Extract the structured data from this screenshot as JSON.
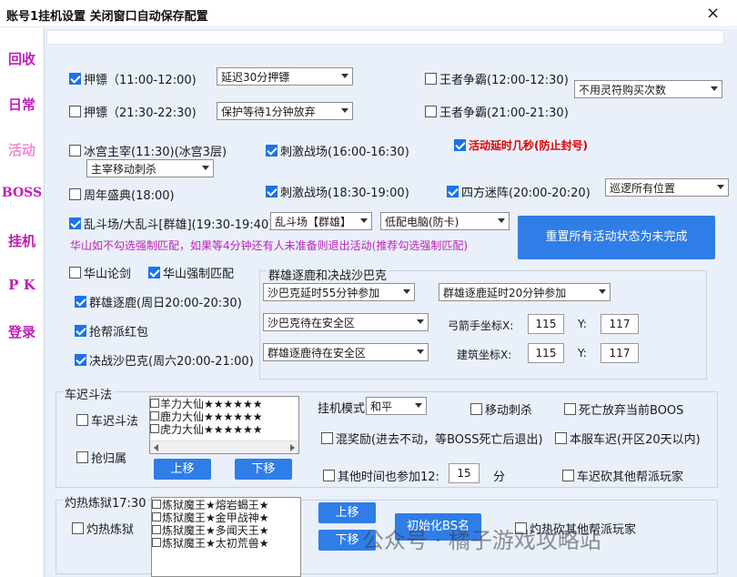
{
  "window": {
    "title": "账号1挂机设置   关闭窗口自动保存配置",
    "close_glyph": "×"
  },
  "sidebar": {
    "items": [
      "回收",
      "日常",
      "活动",
      "BOSS",
      "挂机",
      "P K",
      "登录"
    ],
    "active_color": "#f28ad6",
    "color": "#c01fb7"
  },
  "rows": {
    "yabiao1": {
      "label": "押镖（11:00-12:00)",
      "checked": true,
      "select": "延迟30分押镖"
    },
    "yabiao2": {
      "label": "押镖（21:30-22:30)",
      "checked": false,
      "select": "保护等待1分钟放弃"
    },
    "wangzhe1": {
      "label": "王者争霸(12:00-12:30)",
      "checked": false
    },
    "wangzhe2": {
      "label": "王者争霸(21:00-21:30)",
      "checked": false
    },
    "lingfu_select": "不用灵符购买次数",
    "binggong": {
      "label": "冰宫主宰(11:30)(冰宫3层)",
      "checked": false,
      "select": "主宰移动刺杀"
    },
    "cijizhan1": {
      "label": "刺激战场(16:00-16:30)",
      "checked": true
    },
    "cijizhan2": {
      "label": "刺激战场(18:30-19:00)",
      "checked": true
    },
    "delay": {
      "label": "活动延时几秒(防止封号)",
      "checked": true
    },
    "zhounian": {
      "label": "周年盛典(18:00)",
      "checked": false
    },
    "sifang": {
      "label": "四方迷阵(20:00-20:20)",
      "checked": true,
      "select": "巡逻所有位置"
    },
    "luandou": {
      "label": "乱斗场/大乱斗[群雄](19:30-19:40)",
      "checked": true,
      "select1": "乱斗场【群雄】",
      "select2": "低配电脑(防卡)"
    },
    "huashan_note": "华山如不勾选强制匹配，如果等4分钟还有人未准备则退出活动(推荐勾选强制匹配)",
    "reset_button": "重置所有活动状态为未完成",
    "huashanlunjian": {
      "label": "华山论剑",
      "checked": false
    },
    "huashanqiangzhi": {
      "label": "华山强制匹配",
      "checked": true
    },
    "qunxiong": {
      "label": "群雄逐鹿(周日20:00-20:30)",
      "checked": true
    },
    "qiangbang": {
      "label": "抢帮派红包",
      "checked": true
    },
    "juezhan": {
      "label": "决战沙巴克(周六20:00-21:00)",
      "checked": true
    }
  },
  "sabak_group": {
    "title": "群雄逐鹿和决战沙巴克",
    "sel_a": "沙巴克延时55分钟参加",
    "sel_b": "群雄逐鹿延时20分钟参加",
    "sel_c": "沙巴克待在安全区",
    "sel_d": "群雄逐鹿待在安全区",
    "archer_label": "弓箭手坐标X:",
    "archer_x": "115",
    "archer_y": "117",
    "build_label": "建筑坐标X:",
    "build_x": "115",
    "build_y": "117",
    "y_label": "Y:"
  },
  "checi": {
    "title": "车迟斗法",
    "cb1": "车迟斗法",
    "cb2": "抢归属",
    "list": [
      "羊力大仙★★★★★★",
      "鹿力大仙★★★★★★",
      "虎力大仙★★★★★★"
    ],
    "up": "上移",
    "down": "下移",
    "mode_label": "挂机模式",
    "mode_value": "和平",
    "mobile_stab": "移动刺杀",
    "death_boss": "死亡放弃当前BOOS",
    "mix_reward": "混奖励(进去不动，等BOSS死亡后退出)",
    "server_checi": "本服车迟(开区20天以内)",
    "other_time": "其他时间也参加12:",
    "other_time_value": "15",
    "unit": "分",
    "kill_other": "车迟砍其他帮派玩家"
  },
  "lianyu": {
    "title": "灼热炼狱17:30",
    "cb": "灼热炼狱",
    "list": [
      "炼狱魔王★熔岩蝎王★",
      "炼狱魔王★金甲战神★",
      "炼狱魔王★多闻天王★",
      "炼狱魔王★太初荒兽★"
    ],
    "up": "上移",
    "down": "下移",
    "init_button": "初始化BS名",
    "kill_other": "灼热砍其他帮派玩家"
  },
  "watermark": "公众号 · 橘子游戏攻略站"
}
